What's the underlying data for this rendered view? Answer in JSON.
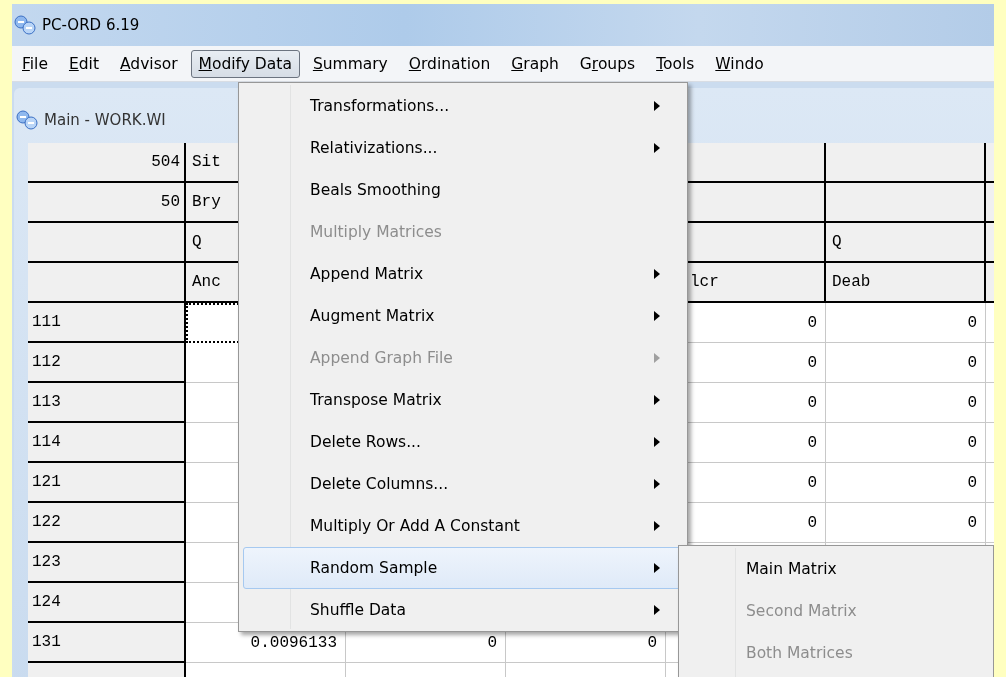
{
  "app": {
    "title": "PC-ORD 6.19"
  },
  "menubar": [
    {
      "key": "F",
      "after": "ile",
      "selected": false
    },
    {
      "key": "E",
      "after": "dit",
      "selected": false
    },
    {
      "key": "A",
      "after": "dvisor",
      "selected": false
    },
    {
      "key": "M",
      "after": "odify Data",
      "selected": true
    },
    {
      "key": "S",
      "after": "ummary",
      "selected": false
    },
    {
      "key": "O",
      "after": "rdination",
      "selected": false
    },
    {
      "key": "G",
      "after": "raph",
      "selected": false
    },
    {
      "before": "G",
      "key": "r",
      "after": "oups",
      "selected": false
    },
    {
      "key": "T",
      "after": "ools",
      "selected": false
    },
    {
      "key": "W",
      "after": "indo",
      "selected": false
    }
  ],
  "document": {
    "title": "Main - WORK.WI",
    "header_rows": [
      {
        "label": "504",
        "cells": [
          "Sit",
          null,
          null,
          null,
          null
        ]
      },
      {
        "label": "50",
        "cells": [
          "Bry",
          null,
          null,
          null,
          null
        ]
      },
      {
        "cells": [
          "Q",
          null,
          null,
          null,
          "Q"
        ]
      },
      {
        "cells": [
          "Anc",
          null,
          null,
          "lcr",
          "Deab"
        ]
      }
    ],
    "rows": [
      {
        "label": "111",
        "cursor": true,
        "cells": [
          null,
          null,
          null,
          "0",
          "0"
        ]
      },
      {
        "label": "112",
        "cursor": false,
        "cells": [
          null,
          null,
          null,
          "0",
          "0"
        ]
      },
      {
        "label": "113",
        "cursor": false,
        "cells": [
          null,
          null,
          null,
          "0",
          "0"
        ]
      },
      {
        "label": "114",
        "cursor": false,
        "cells": [
          null,
          null,
          null,
          "0",
          "0"
        ]
      },
      {
        "label": "121",
        "cursor": false,
        "cells": [
          null,
          null,
          null,
          "0",
          "0"
        ]
      },
      {
        "label": "122",
        "cursor": false,
        "cells": [
          null,
          null,
          null,
          "0",
          "0"
        ]
      },
      {
        "label": "123",
        "cursor": false,
        "cells": [
          null,
          null,
          null,
          null,
          null
        ]
      },
      {
        "label": "124",
        "cursor": false,
        "cells": [
          null,
          null,
          null,
          null,
          null
        ]
      },
      {
        "label": "131",
        "cursor": false,
        "cells": [
          "0.0096133",
          "0",
          "0",
          null,
          null
        ]
      }
    ]
  },
  "menu": {
    "items": [
      {
        "label": "Transformations...",
        "submenu": true,
        "disabled": false,
        "selected": false
      },
      {
        "label": "Relativizations...",
        "submenu": true,
        "disabled": false,
        "selected": false
      },
      {
        "label": "Beals Smoothing",
        "submenu": false,
        "disabled": false,
        "selected": false
      },
      {
        "label": "Multiply Matrices",
        "submenu": false,
        "disabled": true,
        "selected": false
      },
      {
        "label": "Append Matrix",
        "submenu": true,
        "disabled": false,
        "selected": false
      },
      {
        "label": "Augment Matrix",
        "submenu": true,
        "disabled": false,
        "selected": false
      },
      {
        "label": "Append Graph File",
        "submenu": true,
        "disabled": true,
        "selected": false
      },
      {
        "label": "Transpose Matrix",
        "submenu": true,
        "disabled": false,
        "selected": false
      },
      {
        "label": "Delete Rows...",
        "submenu": true,
        "disabled": false,
        "selected": false
      },
      {
        "label": "Delete Columns...",
        "submenu": true,
        "disabled": false,
        "selected": false
      },
      {
        "label": "Multiply Or Add A Constant",
        "submenu": true,
        "disabled": false,
        "selected": false
      },
      {
        "label": "Random Sample",
        "submenu": true,
        "disabled": false,
        "selected": true
      },
      {
        "label": "Shuffle Data",
        "submenu": true,
        "disabled": false,
        "selected": false
      }
    ]
  },
  "submenu": {
    "items": [
      {
        "label": "Main Matrix",
        "disabled": false
      },
      {
        "label": "Second Matrix",
        "disabled": true
      },
      {
        "label": "Both Matrices",
        "disabled": true
      }
    ]
  }
}
